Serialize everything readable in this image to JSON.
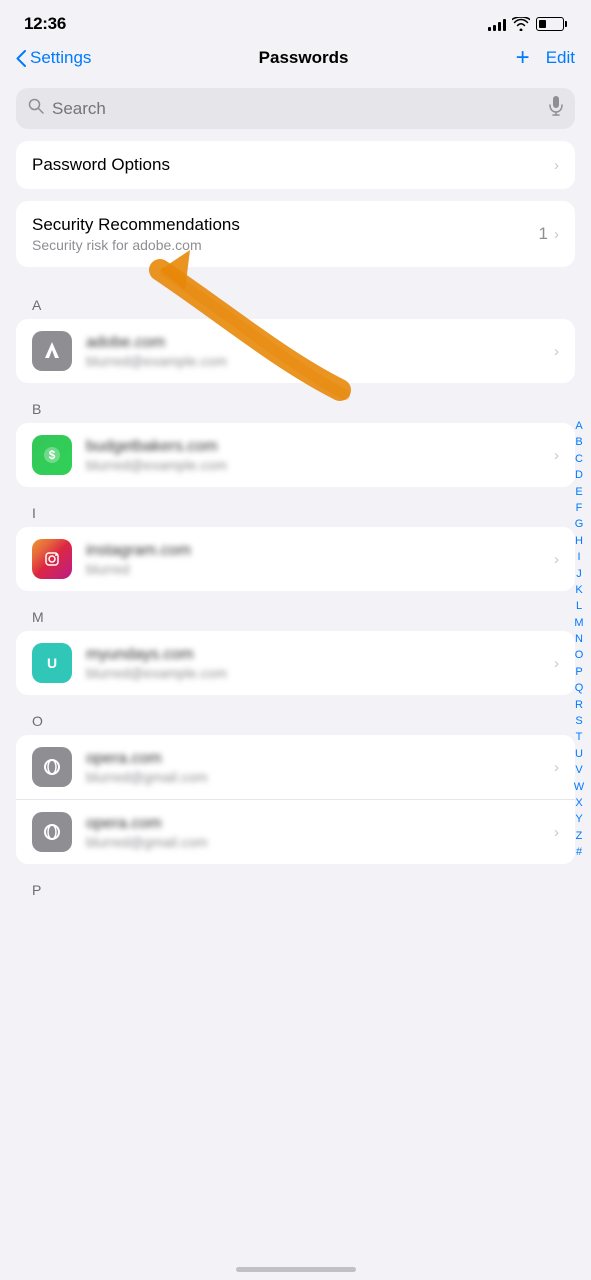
{
  "statusBar": {
    "time": "12:36",
    "battery": "24"
  },
  "navBar": {
    "backLabel": "Settings",
    "title": "Passwords",
    "addLabel": "+",
    "editLabel": "Edit"
  },
  "search": {
    "placeholder": "Search"
  },
  "sections": {
    "passwordOptions": {
      "label": "Password Options"
    },
    "securityRecommendations": {
      "label": "Security Recommendations",
      "subtitle": "Security risk for adobe.com",
      "badge": "1"
    }
  },
  "alphabetIndex": [
    "A",
    "B",
    "C",
    "D",
    "E",
    "F",
    "G",
    "H",
    "I",
    "J",
    "K",
    "L",
    "M",
    "N",
    "O",
    "P",
    "Q",
    "R",
    "S",
    "T",
    "U",
    "V",
    "W",
    "X",
    "Y",
    "Z",
    "#"
  ],
  "sectionHeaders": {
    "a": "A",
    "b": "B",
    "i": "I",
    "m": "M",
    "o": "O",
    "p": "P"
  },
  "entries": [
    {
      "id": "adobe",
      "iconType": "gray",
      "domain": "adobe.com",
      "email": "blurred@example.com",
      "section": "A"
    },
    {
      "id": "budgetbakers",
      "iconType": "green",
      "domain": "budgetbakers.com",
      "email": "blurred@example.com",
      "section": "B"
    },
    {
      "id": "instagram",
      "iconType": "instagram",
      "domain": "instagram.com",
      "email": "blurred",
      "section": "I"
    },
    {
      "id": "myundays",
      "iconType": "teal",
      "domain": "myundays.com",
      "email": "blurred@example.com",
      "section": "M"
    },
    {
      "id": "opera1",
      "iconType": "gray",
      "domain": "opera.com",
      "email": "blurred@gmail.com",
      "section": "O"
    },
    {
      "id": "opera2",
      "iconType": "gray",
      "domain": "opera.com",
      "email": "blurred@gmail.com",
      "section": "O"
    }
  ]
}
